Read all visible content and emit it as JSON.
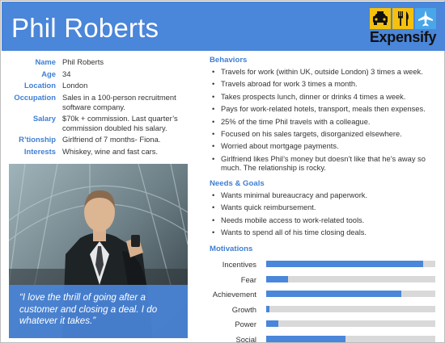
{
  "header": {
    "title": "Phil Roberts",
    "logo_text": "Expensify"
  },
  "logo_icons": [
    "taxi-icon",
    "utensils-icon",
    "airplane-icon"
  ],
  "profile": [
    {
      "label": "Name",
      "value": "Phil Roberts"
    },
    {
      "label": "Age",
      "value": "34"
    },
    {
      "label": "Location",
      "value": "London"
    },
    {
      "label": "Occupation",
      "value": "Sales in a 100-person recruitment software company."
    },
    {
      "label": "Salary",
      "value": "$70k + commission. Last quarter’s commission doubled his salary."
    },
    {
      "label": "R’tionship",
      "value": "Girlfriend of 7 months- Fiona."
    },
    {
      "label": "Interests",
      "value": "Whiskey, wine and fast cars."
    }
  ],
  "quote": "“I love the thrill of going after a customer and closing a deal. I do whatever it takes.”",
  "behaviors": {
    "title": "Behaviors",
    "items": [
      "Travels for work (within UK, outside London) 3 times a week.",
      "Travels abroad for work 3 times a month.",
      "Takes prospects lunch, dinner or drinks 4 times a week.",
      "Pays for work-related hotels, transport, meals then expenses.",
      "25% of the time Phil travels with a colleague.",
      "Focused on his sales targets, disorganized elsewhere.",
      "Worried about mortgage payments.",
      "Girlfriend likes Phil’s money but doesn’t like that he’s away so much. The relationship is rocky."
    ]
  },
  "needs": {
    "title": "Needs & Goals",
    "items": [
      "Wants minimal bureaucracy and paperwork.",
      "Wants quick reimbursement.",
      "Needs mobile access to work-related tools.",
      "Wants to spend all of his time closing deals."
    ]
  },
  "motivations": {
    "title": "Motivations",
    "items": [
      {
        "label": "Incentives",
        "level": 0.93
      },
      {
        "label": "Fear",
        "level": 0.13
      },
      {
        "label": "Achievement",
        "level": 0.8
      },
      {
        "label": "Growth",
        "level": 0.02
      },
      {
        "label": "Power",
        "level": 0.07
      },
      {
        "label": "Social",
        "level": 0.47
      }
    ]
  },
  "colors": {
    "accent": "#4a86d9",
    "label": "#3f7fd3",
    "track": "#d9d9d9",
    "logo_tile": "#f5c10e"
  }
}
